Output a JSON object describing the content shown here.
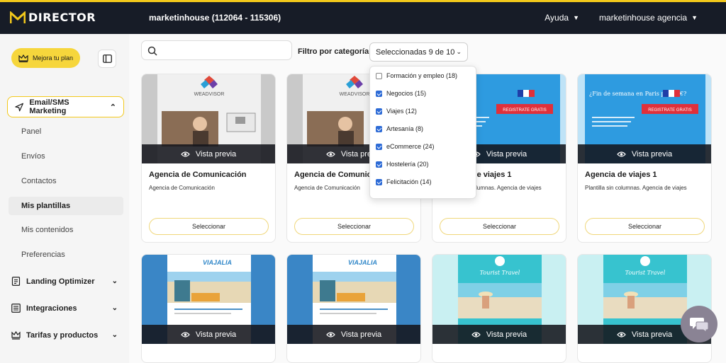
{
  "header": {
    "logo_text": "DIRECTOR",
    "account_title": "marketinhouse (112064 - 115306)",
    "help_label": "Ayuda",
    "account_menu_label": "marketinhouse agencia",
    "accent_color": "#f2c81b",
    "bg_color": "#171c27"
  },
  "sidebar": {
    "upgrade_label": "Mejora tu plan",
    "section_label": "Email/SMS Marketing",
    "items": [
      {
        "label": "Panel",
        "active": false
      },
      {
        "label": "Envíos",
        "active": false
      },
      {
        "label": "Contactos",
        "active": false
      },
      {
        "label": "Mis plantillas",
        "active": true
      },
      {
        "label": "Mis contenidos",
        "active": false
      },
      {
        "label": "Preferencias",
        "active": false
      }
    ],
    "groups": [
      {
        "label": "Landing Optimizer",
        "icon": "document-icon"
      },
      {
        "label": "Integraciones",
        "icon": "grid-list-icon"
      },
      {
        "label": "Tarifas y productos",
        "icon": "crown-icon"
      }
    ]
  },
  "toolbar": {
    "search_placeholder": "",
    "filter_label": "Filtro por categoría:",
    "filter_value": "Seleccionadas 9 de 10"
  },
  "dropdown": {
    "options": [
      {
        "label": "Formación y empleo (18)",
        "checked": false
      },
      {
        "label": "Negocios (15)",
        "checked": true
      },
      {
        "label": "Viajes (12)",
        "checked": true
      },
      {
        "label": "Artesanía (8)",
        "checked": true
      },
      {
        "label": "eCommerce (24)",
        "checked": true
      },
      {
        "label": "Hostelería (20)",
        "checked": true
      },
      {
        "label": "Felicitación (14)",
        "checked": true
      }
    ]
  },
  "cards": [
    {
      "title": "Agencia de Comunicación",
      "desc": "Agencia de Comunicación",
      "preview": "Vista previa",
      "select": "Seleccionar"
    },
    {
      "title": "Agencia de Comunicación",
      "desc": "Agencia de Comunicación",
      "preview": "Vista previa",
      "select": "Seleccionar"
    },
    {
      "title": "Agencia de viajes 1",
      "desc": "Plantilla sin columnas. Agencia de viajes",
      "preview": "Vista previa",
      "select": "Seleccionar"
    },
    {
      "title": "Agencia de viajes 1",
      "desc": "Plantilla sin columnas. Agencia de viajes",
      "preview": "Vista previa",
      "select": "Seleccionar"
    },
    {
      "preview": "Vista previa"
    },
    {
      "preview": "Vista previa"
    },
    {
      "preview": "Vista previa"
    },
    {
      "preview": "Vista previa"
    }
  ],
  "thumb_texts": {
    "weadvisor": "WEADVISOR",
    "paris": "¿Fin de semana en Paris por 75€?",
    "register": "REGISTRATE GRATIS",
    "viajalia": "VIAJALIA",
    "tourist": "Tourist Travel"
  }
}
